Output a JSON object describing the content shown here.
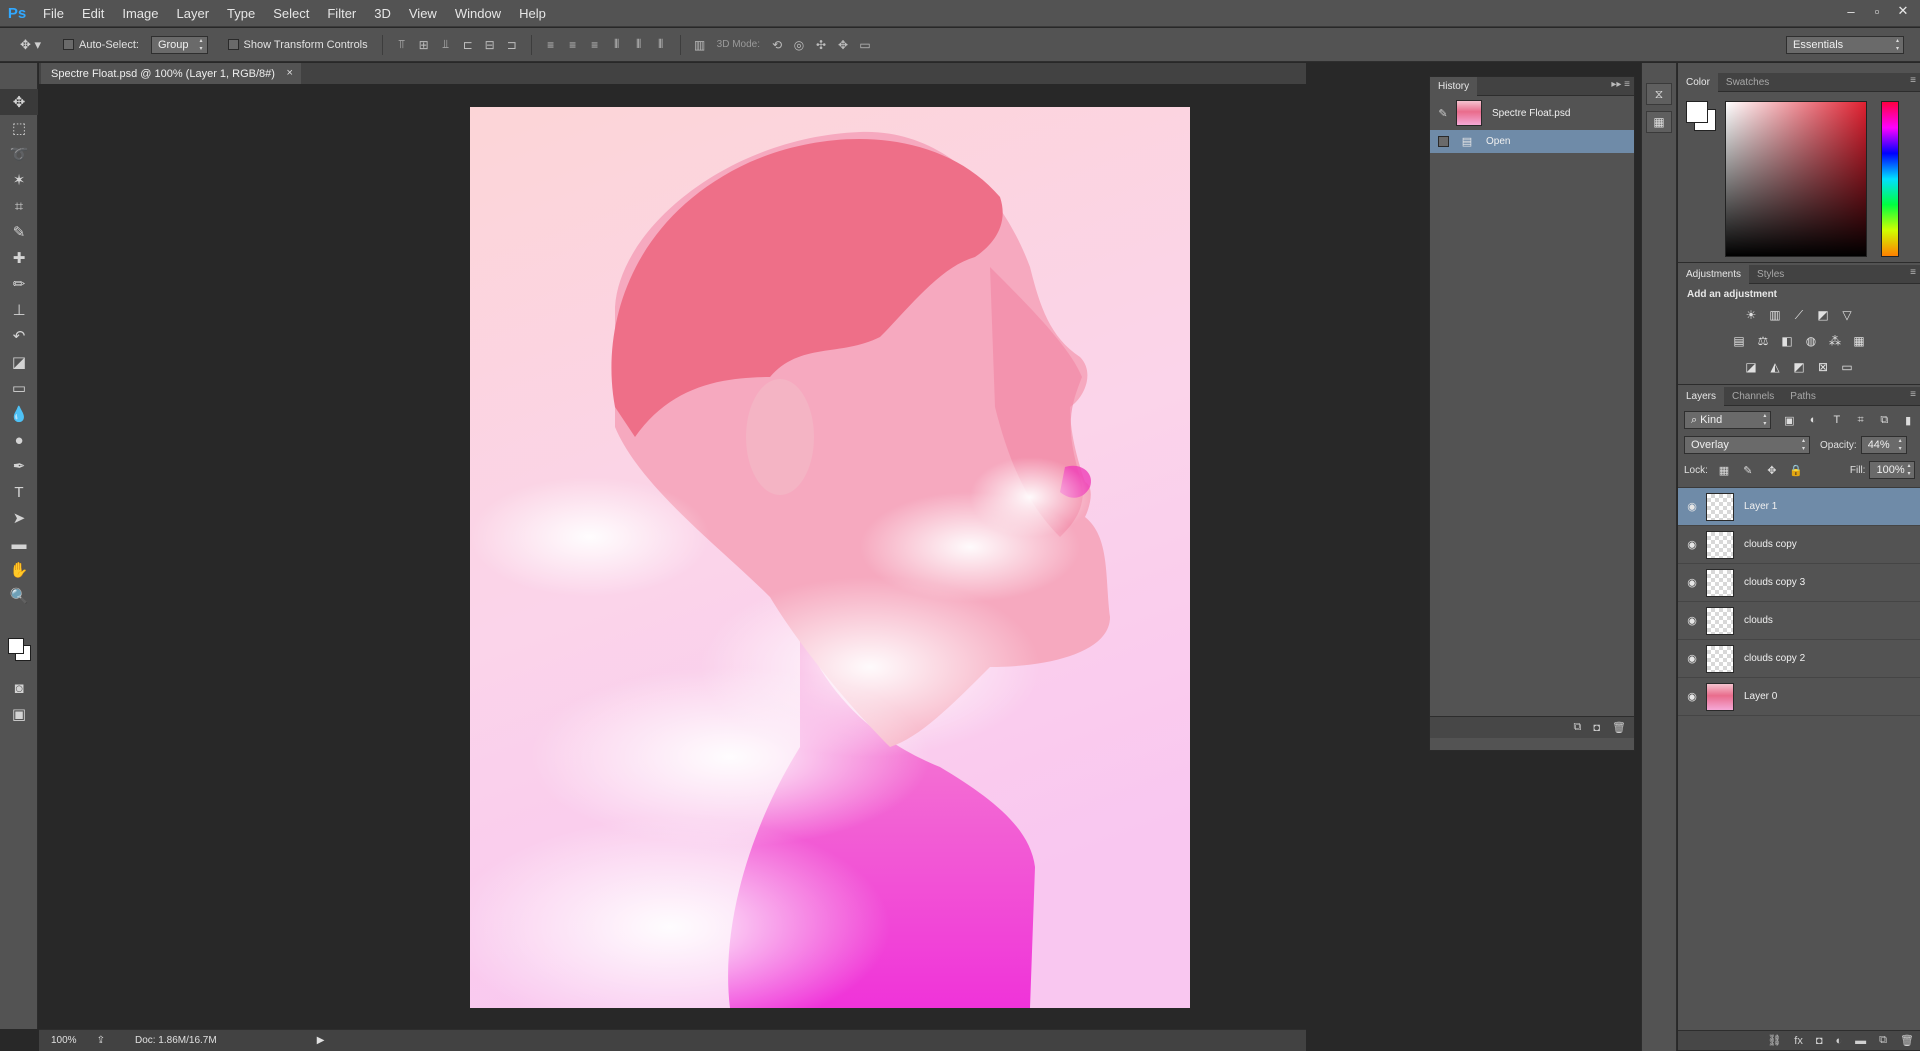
{
  "app": {
    "logo": "Ps",
    "menu": [
      "File",
      "Edit",
      "Image",
      "Layer",
      "Type",
      "Select",
      "Filter",
      "3D",
      "View",
      "Window",
      "Help"
    ],
    "window_controls": [
      "–",
      "▫",
      "✕"
    ]
  },
  "options": {
    "auto_select_label": "Auto-Select:",
    "auto_select_value": "Group",
    "transform_label": "Show Transform Controls",
    "mode_3d_label": "3D Mode:",
    "workspace": "Essentials"
  },
  "document": {
    "tab_title": "Spectre Float.psd @ 100% (Layer 1, RGB/8#)",
    "tab_close": "×",
    "zoom": "100%",
    "doc_size": "Doc: 1.86M/16.7M",
    "artwork_colors": {
      "top": "#fbd3d6",
      "mid": "#f59aca",
      "bottom": "#f24fd9",
      "skin": "#ef6e87"
    }
  },
  "history": {
    "tab": "History",
    "snapshot_name": "Spectre Float.psd",
    "steps": [
      "Open"
    ]
  },
  "color_panel": {
    "tabs": [
      "Color",
      "Swatches"
    ],
    "foreground": "#ffffff",
    "background": "#ffffff",
    "field_hue": "#e02030"
  },
  "adjustments": {
    "tabs": [
      "Adjustments",
      "Styles"
    ],
    "heading": "Add an adjustment"
  },
  "layers_panel": {
    "tabs": [
      "Layers",
      "Channels",
      "Paths"
    ],
    "filter_kind": "Kind",
    "blend_mode": "Overlay",
    "opacity_label": "Opacity:",
    "opacity_value": "44%",
    "lock_label": "Lock:",
    "fill_label": "Fill:",
    "fill_value": "100%",
    "layers": [
      {
        "name": "Layer 1",
        "selected": true,
        "thumb": "transparent"
      },
      {
        "name": "clouds copy",
        "selected": false,
        "thumb": "transparent"
      },
      {
        "name": "clouds copy 3",
        "selected": false,
        "thumb": "transparent"
      },
      {
        "name": "clouds",
        "selected": false,
        "thumb": "transparent"
      },
      {
        "name": "clouds copy 2",
        "selected": false,
        "thumb": "transparent"
      },
      {
        "name": "Layer 0",
        "selected": false,
        "thumb": "photo"
      }
    ]
  }
}
